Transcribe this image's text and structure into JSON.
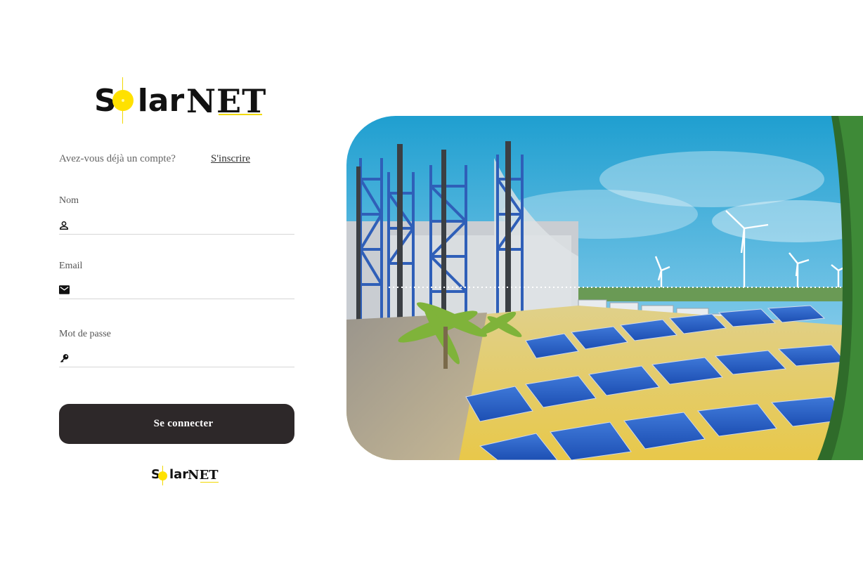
{
  "brand": {
    "word1_first": "S",
    "word1_rest": "lar",
    "word2": "NET"
  },
  "account": {
    "question": "Avez-vous déjà un compte?",
    "link": "S'inscrire"
  },
  "form": {
    "name_label": "Nom",
    "email_label": "Email",
    "password_label": "Mot de passe",
    "name_value": "",
    "email_value": "",
    "password_value": ""
  },
  "submit_label": "Se connecter",
  "icons": {
    "name": "person-icon",
    "email": "mail-icon",
    "password": "key-icon"
  },
  "colors": {
    "brand_yellow": "#ffe100",
    "button": "#2d2829"
  }
}
